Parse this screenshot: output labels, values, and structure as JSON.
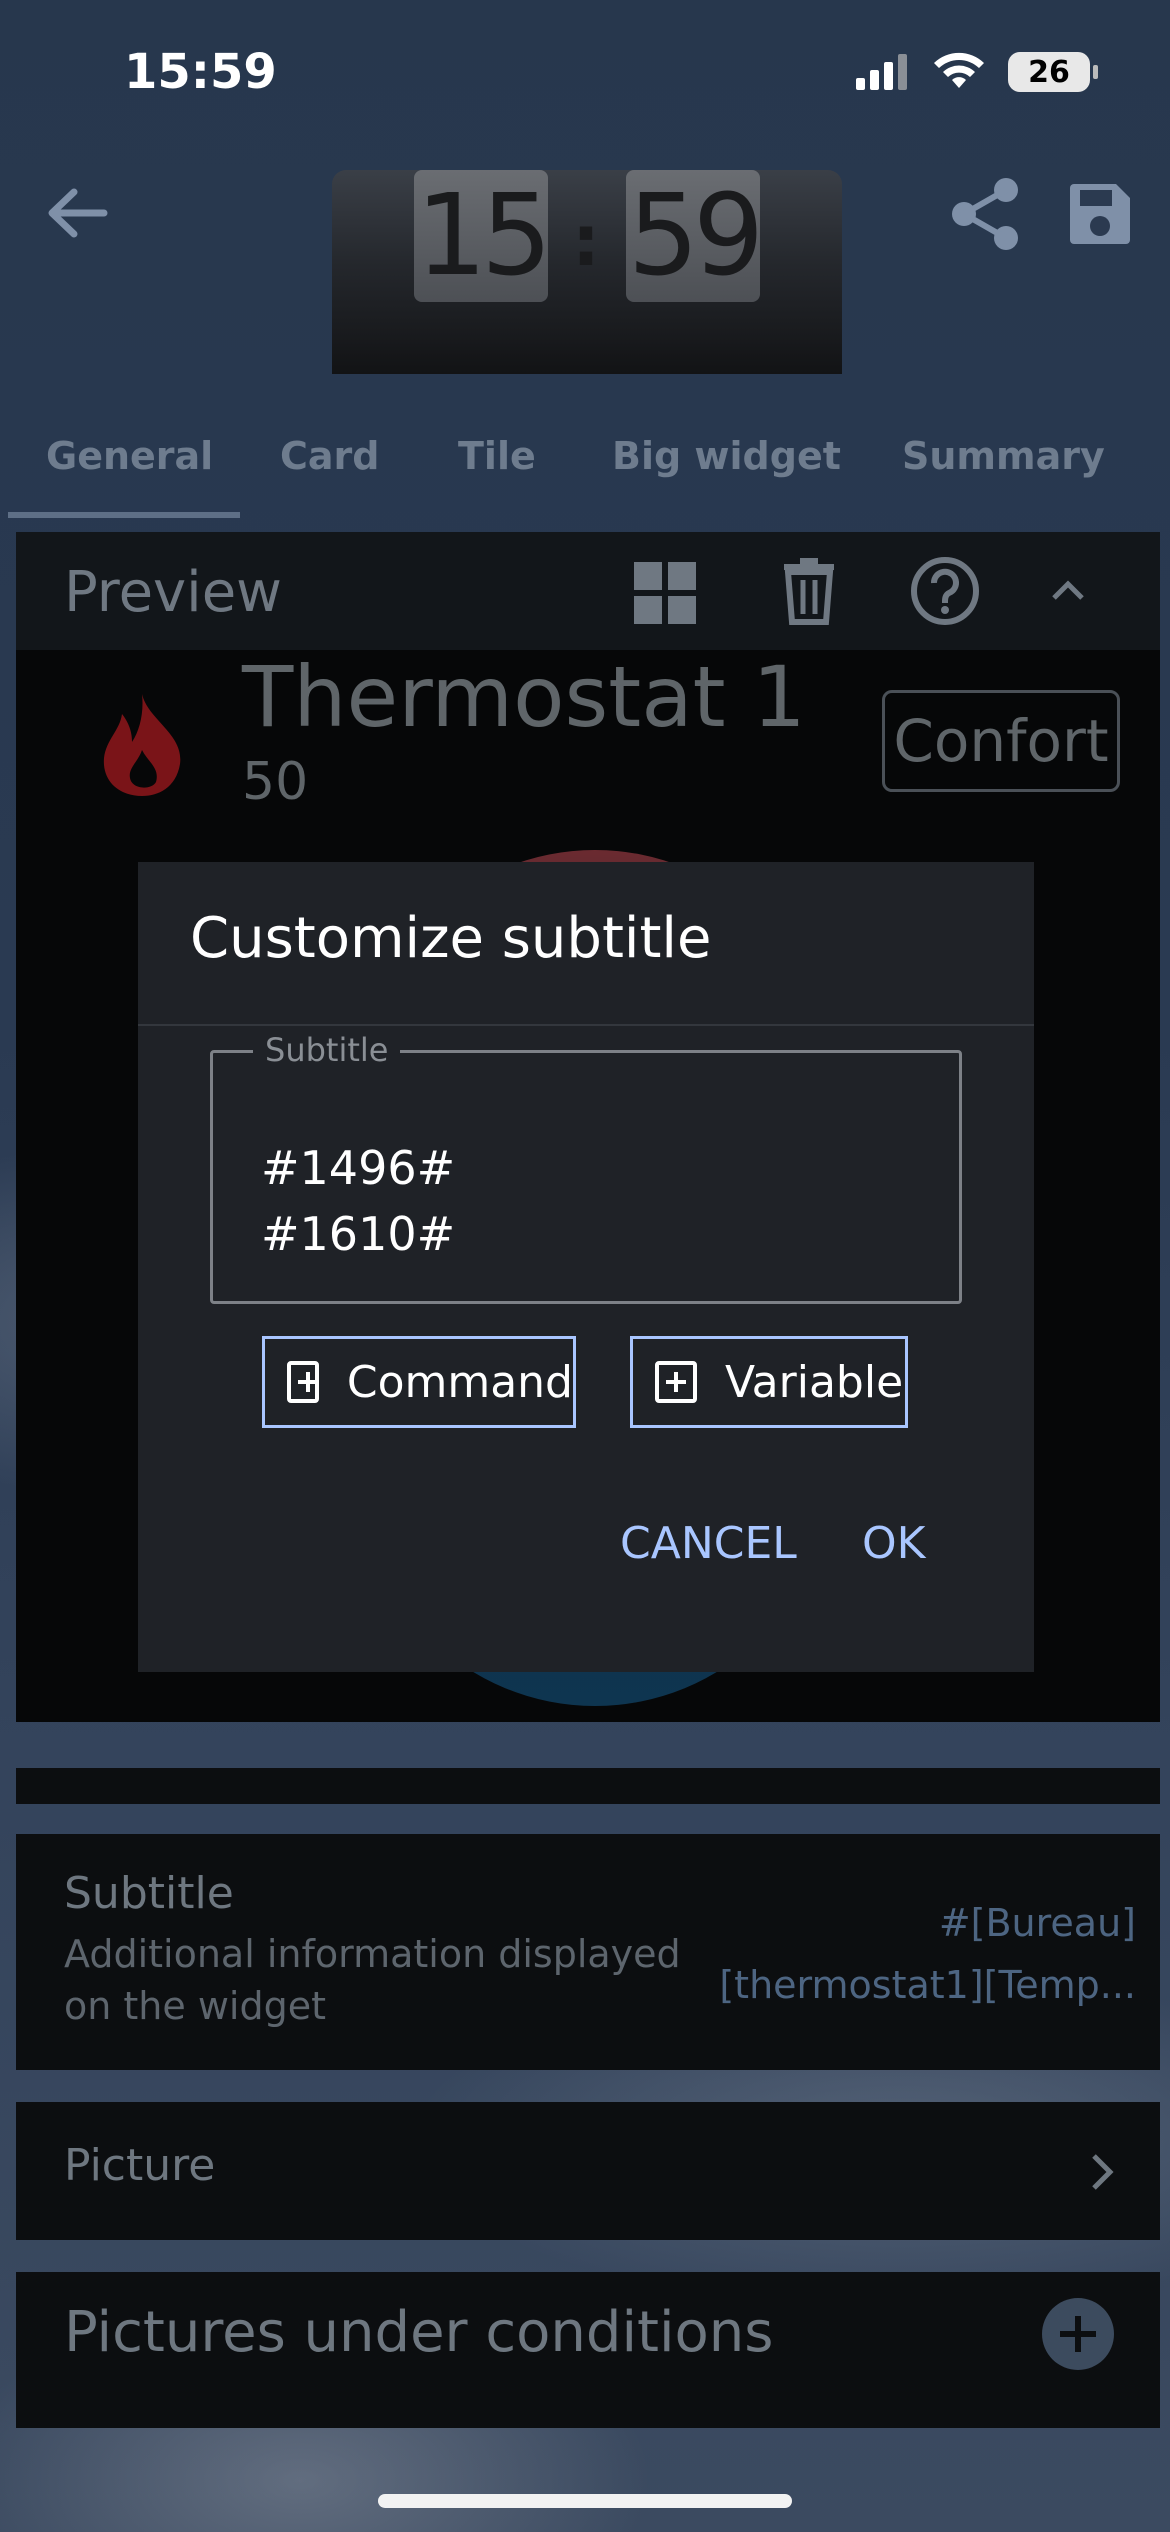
{
  "status_bar": {
    "time": "15:59",
    "battery": "26"
  },
  "header": {
    "clock_hours": "15",
    "clock_minutes": "59",
    "clock_colon": ":"
  },
  "tabs": [
    {
      "label": "General",
      "active": true
    },
    {
      "label": "Card"
    },
    {
      "label": "Tile"
    },
    {
      "label": "Big widget"
    },
    {
      "label": "Summary"
    }
  ],
  "preview": {
    "title": "Preview",
    "widget_title": "Thermostat 1",
    "widget_subtitle": "50",
    "mode_badge": "Confort"
  },
  "settings": {
    "subtitle": {
      "label": "Subtitle",
      "description": "Additional information displayed on the widget",
      "value_line1": "#[Bureau]",
      "value_line2": "[thermostat1][Temp..."
    },
    "picture": {
      "label": "Picture"
    },
    "pictures_conditions": {
      "label": "Pictures under conditions"
    }
  },
  "dialog": {
    "title": "Customize subtitle",
    "field_label": "Subtitle",
    "field_value": "#1496#\n#1610#",
    "command_button": "Command",
    "variable_button": "Variable",
    "cancel_button": "CANCEL",
    "ok_button": "OK"
  },
  "colors": {
    "accent": "#a9c6ff",
    "dialog_bg": "#1f2227",
    "flame": "#8b1a1f"
  }
}
